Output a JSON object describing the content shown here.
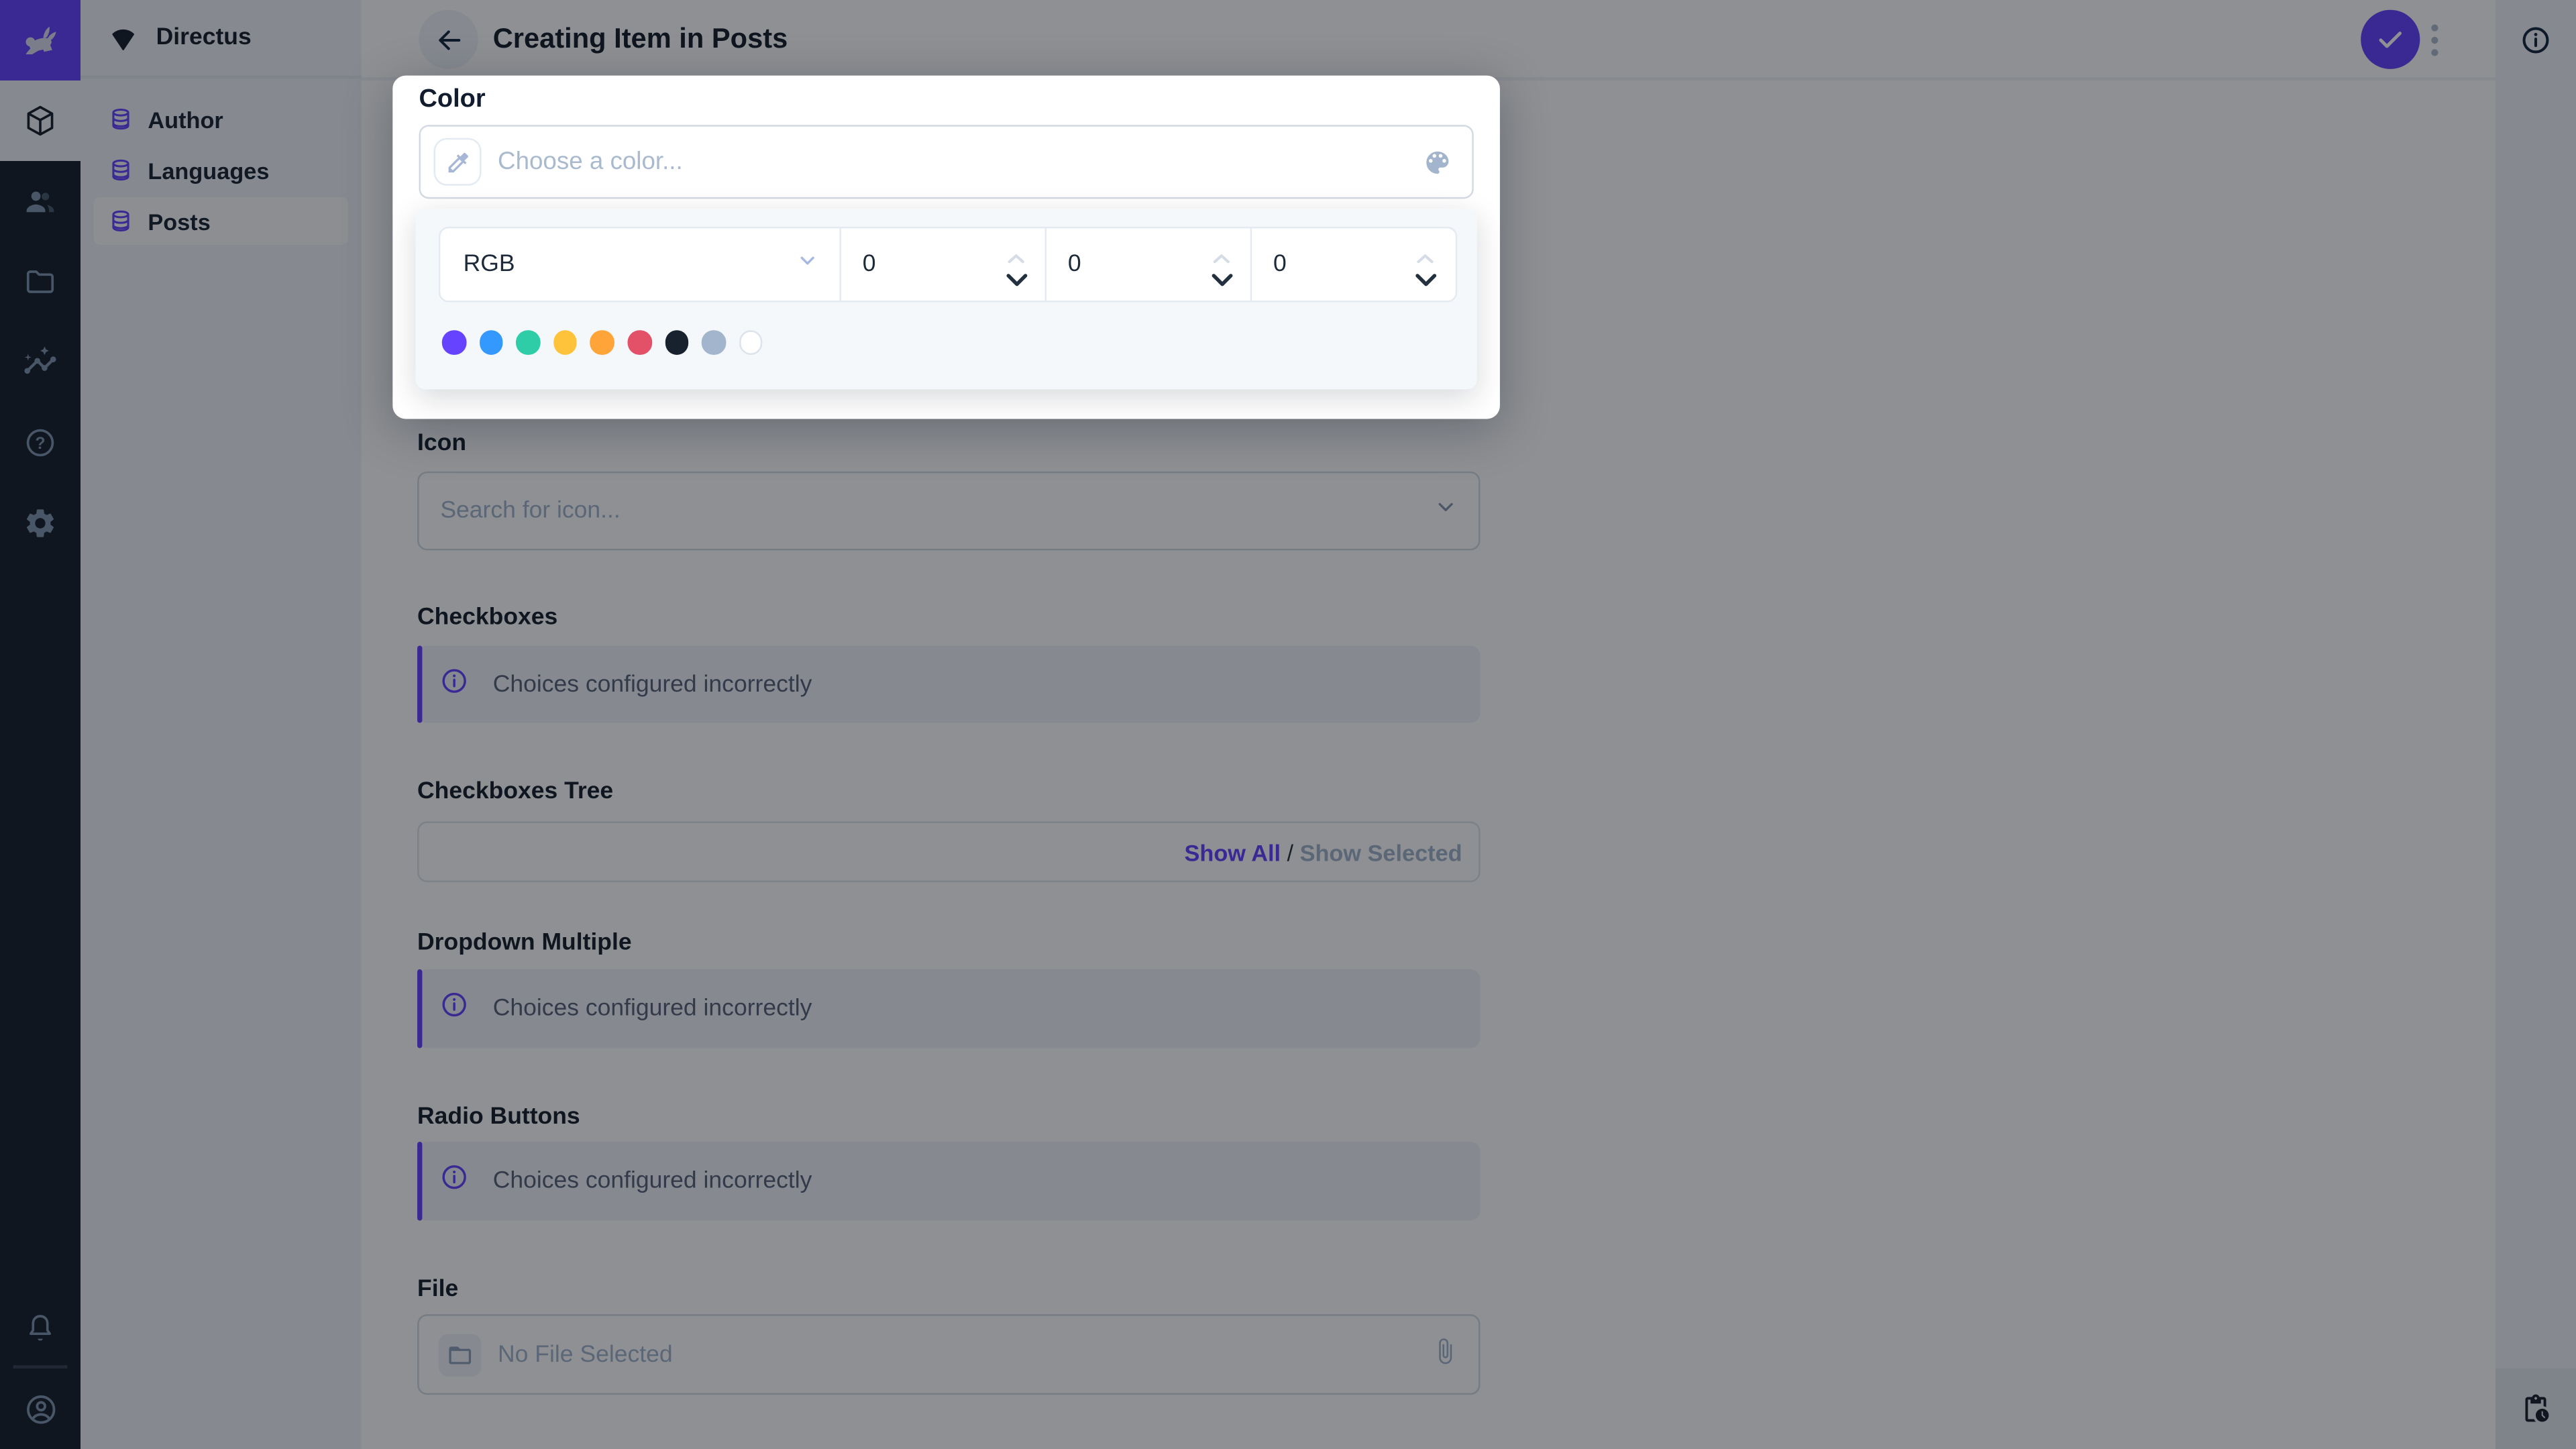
{
  "module_bar": {
    "modules": [
      {
        "name": "content",
        "active": true
      },
      {
        "name": "user-directory",
        "active": false
      },
      {
        "name": "file-library",
        "active": false
      },
      {
        "name": "insights",
        "active": false
      },
      {
        "name": "documentation",
        "active": false
      },
      {
        "name": "settings",
        "active": false
      }
    ]
  },
  "nav": {
    "project_name": "Directus",
    "items": [
      {
        "label": "Author",
        "active": false
      },
      {
        "label": "Languages",
        "active": false
      },
      {
        "label": "Posts",
        "active": true
      }
    ]
  },
  "header": {
    "title": "Creating Item in Posts"
  },
  "color_popup": {
    "field_label": "Color",
    "input_placeholder": "Choose a color...",
    "mode_selected": "RGB",
    "channel_values": {
      "r": "0",
      "g": "0",
      "b": "0"
    },
    "swatches": [
      "#6644FF",
      "#3399FF",
      "#2ECDA7",
      "#FFC23B",
      "#FFA439",
      "#E35169",
      "#18222F",
      "#A2B5CD",
      "#FFFFFF"
    ]
  },
  "fields": {
    "icon": {
      "label": "Icon",
      "placeholder": "Search for icon..."
    },
    "checkboxes": {
      "label": "Checkboxes",
      "notice": "Choices configured incorrectly"
    },
    "checkboxes_tree": {
      "label": "Checkboxes Tree",
      "show_all": "Show All",
      "separator": "/",
      "show_selected": "Show Selected"
    },
    "dropdown_multiple": {
      "label": "Dropdown Multiple",
      "notice": "Choices configured incorrectly"
    },
    "radio_buttons": {
      "label": "Radio Buttons",
      "notice": "Choices configured incorrectly"
    },
    "file": {
      "label": "File",
      "placeholder": "No File Selected"
    }
  },
  "colors": {
    "accent": "#6644FF",
    "module_bar_bg": "#18222F",
    "nav_bg": "#F0F4F9",
    "border": "#D3DAE4",
    "placeholder_text": "#A2B5CD"
  }
}
